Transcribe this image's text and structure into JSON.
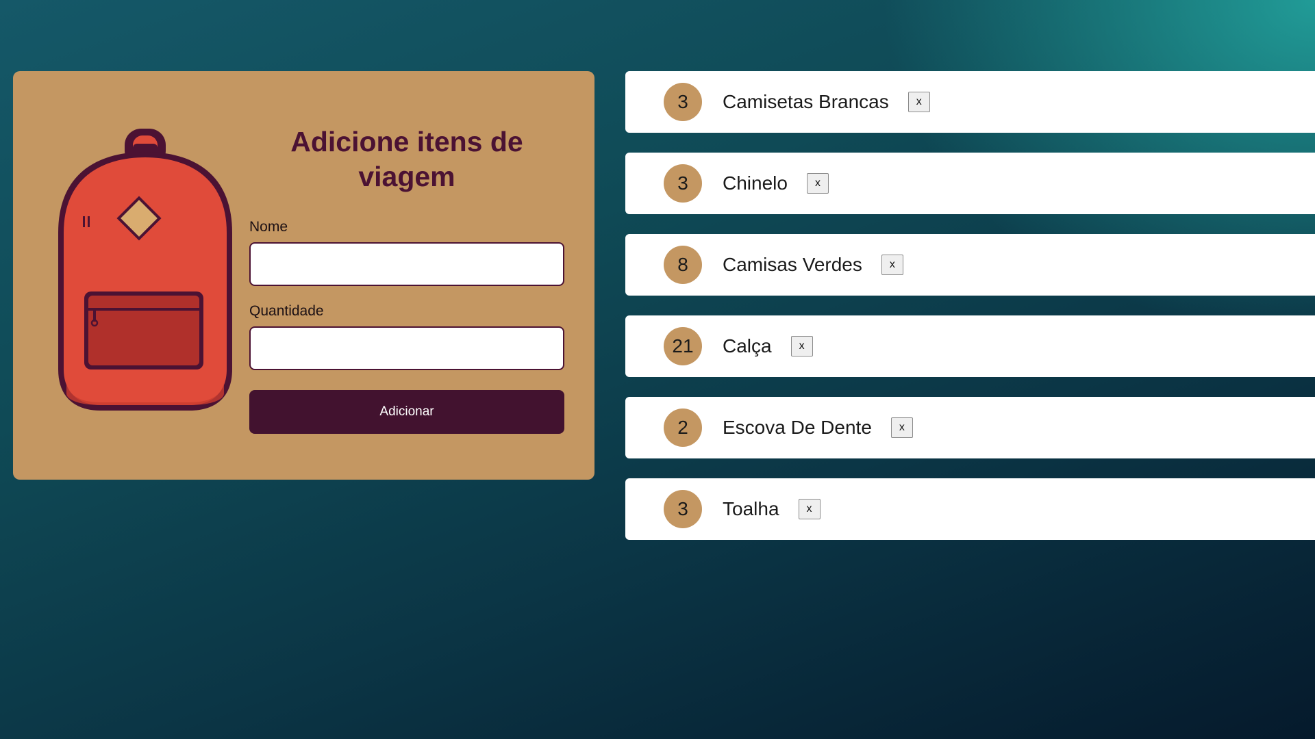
{
  "form": {
    "title": "Adicione itens de viagem",
    "name_label": "Nome",
    "name_value": "",
    "quantity_label": "Quantidade",
    "quantity_value": "",
    "submit_label": "Adicionar"
  },
  "items": [
    {
      "quantity": "3",
      "name": "Camisetas Brancas",
      "remove_label": "x"
    },
    {
      "quantity": "3",
      "name": "Chinelo",
      "remove_label": "x"
    },
    {
      "quantity": "8",
      "name": "Camisas Verdes",
      "remove_label": "x"
    },
    {
      "quantity": "21",
      "name": "Calça",
      "remove_label": "x"
    },
    {
      "quantity": "2",
      "name": "Escova De Dente",
      "remove_label": "x"
    },
    {
      "quantity": "3",
      "name": "Toalha",
      "remove_label": "x"
    }
  ],
  "colors": {
    "card": "#c49762",
    "accent_dark": "#42122f",
    "backpack": "#e04b3a",
    "background_top": "#1f9b97",
    "background_bottom": "#051a2c"
  },
  "icons": {
    "illustration": "backpack-icon"
  }
}
